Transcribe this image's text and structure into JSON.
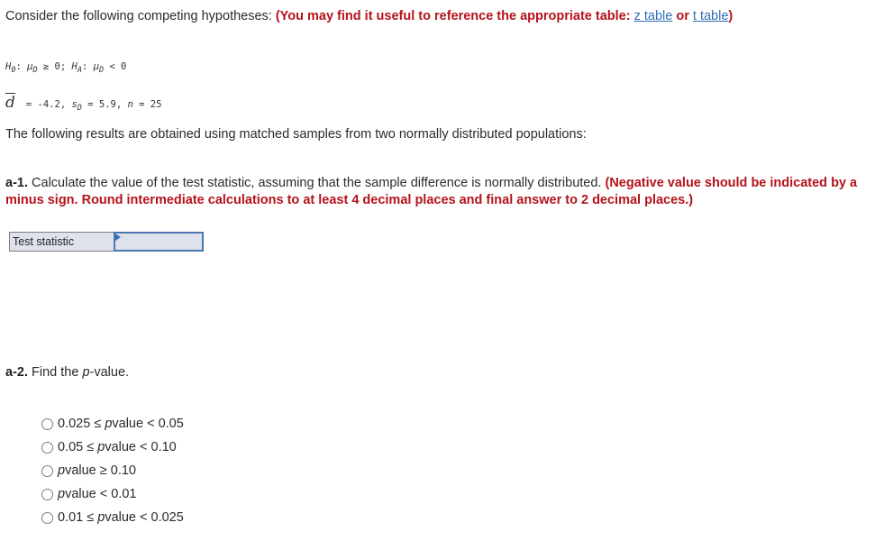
{
  "intro": {
    "text": "Consider the following competing hypotheses: ",
    "note_open": "(You may find it useful to reference the appropriate table: ",
    "z_link": "z table",
    "or": " or ",
    "t_link": "t table",
    "note_close": ")"
  },
  "hypotheses": {
    "h0": "H",
    "h0_sub": "0",
    "h0_rel": ": ",
    "mu": "μ",
    "mu_sub": "D",
    "h0_cond": " ≥ 0; ",
    "ha": "H",
    "ha_sub": "A",
    "ha_rel": ": ",
    "ha_cond": " < 0"
  },
  "stats": {
    "dbar": "d",
    "dbar_value": "= -4.2, ",
    "s": "s",
    "s_sub": "D",
    "s_value": " = 5.9, ",
    "n": "n",
    "n_value": " = 25"
  },
  "results_text": "The following results are obtained using matched samples from two normally distributed populations:",
  "a1": {
    "label": "a-1.",
    "text": " Calculate the value of the test statistic, assuming that the sample difference is normally distributed. ",
    "note": "(Negative value should be indicated by a minus sign. Round intermediate calculations to at least 4 decimal places and final answer to 2 decimal places.)"
  },
  "answer_table": {
    "label": "Test statistic",
    "value": ""
  },
  "a2": {
    "label": "a-2.",
    "text_before": " Find the ",
    "p": "p",
    "text_after": "-value."
  },
  "options": [
    {
      "pre": "0.025 ≤ ",
      "p": "p",
      "post": " value < 0.05",
      "selected": false
    },
    {
      "pre": "0.05 ≤ ",
      "p": "p",
      "post": " value < 0.10",
      "selected": false
    },
    {
      "pre": "",
      "p": "p",
      "post": " value ≥ 0.10",
      "selected": false
    },
    {
      "pre": "",
      "p": "p",
      "post": " value < 0.01",
      "selected": false
    },
    {
      "pre": "0.01 ≤ ",
      "p": "p",
      "post": " value < 0.025",
      "selected": false
    }
  ]
}
